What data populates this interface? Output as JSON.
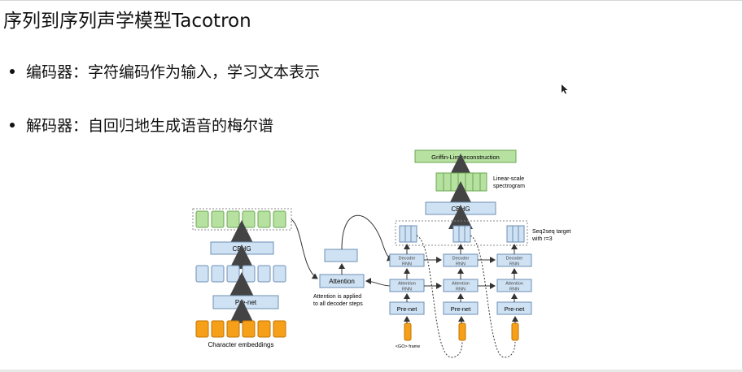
{
  "slide": {
    "title": "序列到序列声学模型Tacotron",
    "bullets": [
      "编码器：字符编码作为输入，学习文本表示",
      "解码器：自回归地生成语音的梅尔谱"
    ]
  },
  "diagram": {
    "griffin_lim": "Griffin-Lim reconstruction",
    "linear_scale_1": "Linear-scale",
    "linear_scale_2": "spectrogram",
    "cbhg_decoder": "CBHG",
    "seq2seq_1": "Seq2seq target",
    "seq2seq_2": "with r=3",
    "cbhg_encoder": "CBHG",
    "prenet_encoder": "Pre-net",
    "char_embeddings": "Character embeddings",
    "attention": "Attention",
    "attention_note_1": "Attention is applied",
    "attention_note_2": "to all decoder steps",
    "decoder_rnn_1": "Decoder",
    "decoder_rnn_2": "RNN",
    "attention_rnn_1": "Attention",
    "attention_rnn_2": "RNN",
    "prenet_decoder": "Pre-net",
    "go_frame": "<GO> frame"
  },
  "colors": {
    "green_fill": "#b7e1a1",
    "green_stroke": "#6aa84f",
    "blue_fill": "#cfe2f3",
    "blue_stroke": "#6d8fb5",
    "orange_fill": "#f6a01a",
    "orange_stroke": "#c27400"
  }
}
